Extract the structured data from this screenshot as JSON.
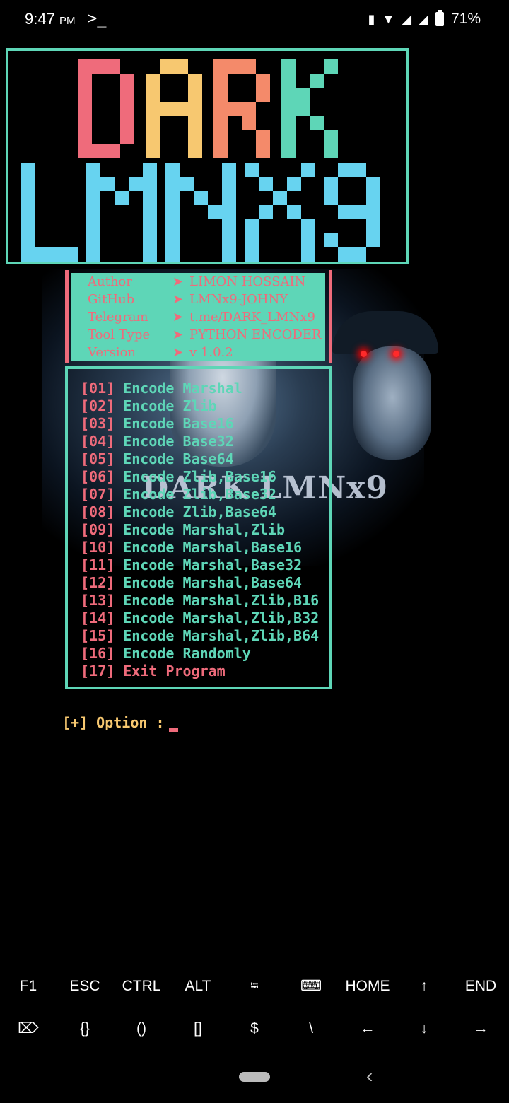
{
  "status_bar": {
    "time": "9:47",
    "ampm": "PM",
    "prompt_icon": ">_",
    "battery": "71%",
    "icons": [
      "vibrate-icon",
      "wifi-off-icon",
      "signal-icon",
      "signal-4g-icon",
      "battery-icon"
    ]
  },
  "logo": {
    "line1": "DARK",
    "line2": "LMNX9"
  },
  "info": [
    {
      "key": "Author",
      "value": "LIMON HOSSAIN"
    },
    {
      "key": "GitHub",
      "value": "LMNx9-JOHNY"
    },
    {
      "key": "Telegram",
      "value": "t.me/DARK_LMNx9"
    },
    {
      "key": "Tool Type",
      "value": "PYTHON ENCODER"
    },
    {
      "key": "Version",
      "value": "v 1.0.2"
    }
  ],
  "watermark": "DARK LMNx9",
  "menu": [
    {
      "num": "[01]",
      "label": "Encode Marshal"
    },
    {
      "num": "[02]",
      "label": "Encode Zlib"
    },
    {
      "num": "[03]",
      "label": "Encode Base16"
    },
    {
      "num": "[04]",
      "label": "Encode Base32"
    },
    {
      "num": "[05]",
      "label": "Encode Base64"
    },
    {
      "num": "[06]",
      "label": "Encode Zlib,Base16"
    },
    {
      "num": "[07]",
      "label": "Encode Zlib,Base32"
    },
    {
      "num": "[08]",
      "label": "Encode Zlib,Base64"
    },
    {
      "num": "[09]",
      "label": "Encode Marshal,Zlib"
    },
    {
      "num": "[10]",
      "label": "Encode Marshal,Base16"
    },
    {
      "num": "[11]",
      "label": "Encode Marshal,Base32"
    },
    {
      "num": "[12]",
      "label": "Encode Marshal,Base64"
    },
    {
      "num": "[13]",
      "label": "Encode Marshal,Zlib,B16"
    },
    {
      "num": "[14]",
      "label": "Encode Marshal,Zlib,B32"
    },
    {
      "num": "[15]",
      "label": "Encode Marshal,Zlib,B64"
    },
    {
      "num": "[16]",
      "label": "Encode Randomly"
    },
    {
      "num": "[17]",
      "label": "Exit Program"
    }
  ],
  "prompt": "[+] Option :",
  "extra_keys": {
    "row1": [
      "F1",
      "ESC",
      "CTRL",
      "ALT",
      "⭾",
      "⌨",
      "HOME",
      "↑",
      "END"
    ],
    "row2": [
      "⌦",
      "{}",
      "()",
      "[]",
      "$",
      "\\",
      "←",
      "↓",
      "→"
    ]
  },
  "colors": {
    "teal": "#5ed6b7",
    "pink": "#ef6b7b",
    "yellow": "#f7c870",
    "orange": "#f48a6a",
    "cyan": "#67d3f0"
  }
}
